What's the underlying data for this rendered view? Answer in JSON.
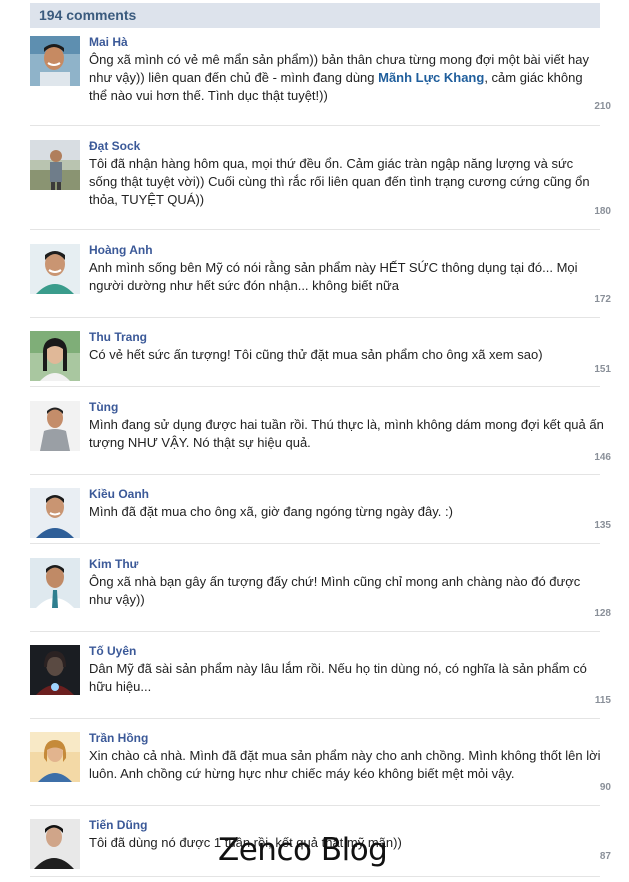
{
  "header": {
    "count_label": "194 comments"
  },
  "comments": [
    {
      "name": "Mai Hà",
      "text_before": "Ông xã mình có vẻ mê mẩn sản phẩm)) bản thân chưa từng mong đợi một bài viết hay như vậy)) liên quan đến chủ đề - mình đang dùng ",
      "link": "Mãnh Lực Khang",
      "text_after": ", cảm giác không thể nào vui hơn thế. Tình dục thật tuyệt!))",
      "likes": "210",
      "avatar": "avatar-man-smiling"
    },
    {
      "name": "Đạt Sock",
      "text_before": "Tôi đã nhận hàng hôm qua, mọi thứ đều ổn. Cảm giác tràn ngập năng lượng và sức sống thật tuyệt vời)) Cuối cùng thì rắc rối liên quan đến tình trạng cương cứng cũng ổn thỏa, TUYỆT QUÁ))",
      "likes": "180",
      "avatar": "avatar-man-outdoor"
    },
    {
      "name": "Hoàng Anh",
      "text_before": "Anh mình sống bên Mỹ có nói rằng sản phẩm này HẾT SỨC thông dụng tại đó... Mọi người dường như hết sức đón nhận... không biết nữa",
      "likes": "172",
      "avatar": "avatar-man-teal-shirt"
    },
    {
      "name": "Thu Trang",
      "text_before": "Có vẻ hết sức ấn tượng! Tôi cũng thử đặt mua sản phẩm cho ông xã xem sao)",
      "likes": "151",
      "avatar": "avatar-woman-smiling"
    },
    {
      "name": "Tùng",
      "text_before": "Mình đang sử dụng được hai tuần rồi. Thú thực là, mình không dám mong đợi kết quả ấn tượng NHƯ VẬY. Nó thật sự hiệu quả.",
      "likes": "146",
      "avatar": "avatar-man-grey-shirt"
    },
    {
      "name": "Kiều Oanh",
      "text_before": "Mình đã đặt mua cho ông xã, giờ đang ngóng từng ngày đây. :)",
      "likes": "135",
      "avatar": "avatar-man-blue-shirt"
    },
    {
      "name": "Kim Thư",
      "text_before": "Ông xã nhà bạn gây ấn tượng đấy chứ! Mình cũng chỉ mong anh chàng nào đó được như vậy))",
      "likes": "128",
      "avatar": "avatar-man-tie"
    },
    {
      "name": "Tố Uyên",
      "text_before": "Dân Mỹ đã sài sản phẩm này lâu lắm rồi. Nếu họ tin dùng nó, có nghĩa là sản phẩm có hữu hiệu...",
      "likes": "115",
      "avatar": "avatar-armor-figure"
    },
    {
      "name": "Trần Hồng",
      "text_before": "Xin chào cả nhà. Mình đã đặt mua sản phẩm này cho anh chồng. Mình không thốt lên lời luôn. Anh chồng cứ hừng hực như chiếc máy kéo không biết mệt mỏi vậy.",
      "likes": "90",
      "avatar": "avatar-woman-sunlight"
    },
    {
      "name": "Tiến Dũng",
      "text_before": "Tôi đã dùng nó được 1 tuần rồi, kết quả thật mỹ mãn))",
      "likes": "87",
      "avatar": "avatar-man-dark-shirt"
    }
  ],
  "watermark": "Zenco Blog"
}
